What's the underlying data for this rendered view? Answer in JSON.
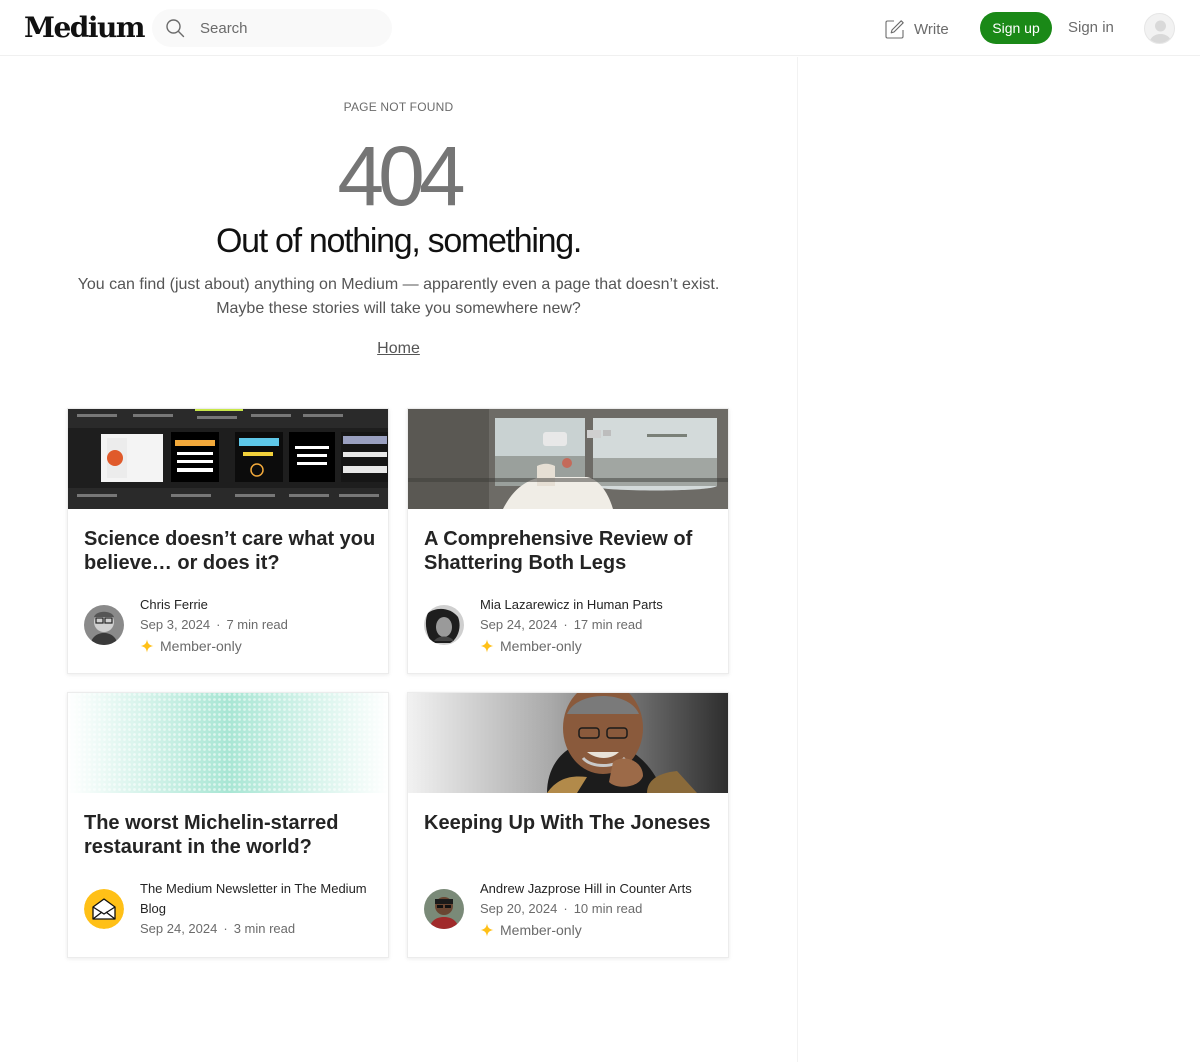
{
  "header": {
    "logo": "Medium",
    "search_placeholder": "Search",
    "write_label": "Write",
    "signup_label": "Sign up",
    "signin_label": "Sign in"
  },
  "notfound": {
    "label": "PAGE NOT FOUND",
    "code": "404",
    "headline": "Out of nothing, something.",
    "line1": "You can find (just about) anything on Medium — apparently even a page that doesn’t exist.",
    "line2": "Maybe these stories will take you somewhere new?",
    "home_link": "Home"
  },
  "member_only_label": "Member-only",
  "colors": {
    "brand_green": "#1a8917",
    "member_star": "#ffc017",
    "text_primary": "#242424",
    "text_secondary": "#6b6b6b"
  },
  "stories": [
    {
      "title": "Science doesn’t care what you believe… or does it?",
      "author": "Chris Ferrie",
      "date": "Sep 3, 2024",
      "read_time": "7 min read",
      "member_only": true
    },
    {
      "title": "A Comprehensive Review of Shattering Both Legs",
      "author": "Mia Lazarewicz in Human Parts",
      "date": "Sep 24, 2024",
      "read_time": "17 min read",
      "member_only": true
    },
    {
      "title": "The worst Michelin-starred restaurant in the world?",
      "author": "The Medium Newsletter in The Medium Blog",
      "date": "Sep 24, 2024",
      "read_time": "3 min read",
      "member_only": false
    },
    {
      "title": "Keeping Up With The Joneses",
      "author": "Andrew Jazprose Hill in Counter Arts",
      "date": "Sep 20, 2024",
      "read_time": "10 min read",
      "member_only": true
    }
  ]
}
